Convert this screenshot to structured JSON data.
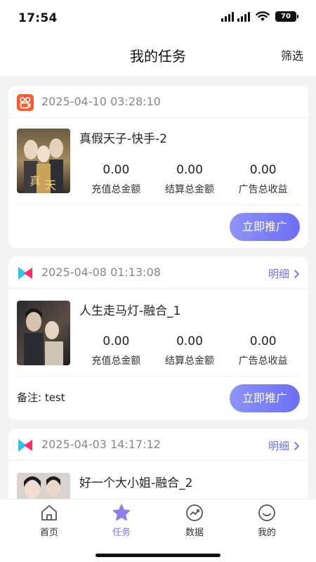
{
  "status_bar": {
    "time": "17:54",
    "battery": "70"
  },
  "header": {
    "title": "我的任务",
    "filter_label": "筛选"
  },
  "cards": [
    {
      "platform": "kuaishou",
      "date": "2025-04-10 03:28:10",
      "title": "真假天子-快手-2",
      "stats": [
        {
          "value": "0.00",
          "label": "充值总金额"
        },
        {
          "value": "0.00",
          "label": "结算总金额"
        },
        {
          "value": "0.00",
          "label": "广告总收益"
        }
      ],
      "button_label": "立即推广"
    },
    {
      "platform": "fusion",
      "date": "2025-04-08 01:13:08",
      "detail_label": "明细",
      "title": "人生走马灯-融合_1",
      "stats": [
        {
          "value": "0.00",
          "label": "充值总金额"
        },
        {
          "value": "0.00",
          "label": "结算总金额"
        },
        {
          "value": "0.00",
          "label": "广告总收益"
        }
      ],
      "remark": "备注: test",
      "button_label": "立即推广"
    },
    {
      "platform": "fusion",
      "date": "2025-04-03 14:17:12",
      "detail_label": "明细",
      "title": "好一个大小姐-融合_2"
    }
  ],
  "tab_bar": {
    "items": [
      {
        "label": "首页",
        "icon": "home-icon",
        "active": false
      },
      {
        "label": "任务",
        "icon": "star-icon",
        "active": true
      },
      {
        "label": "数据",
        "icon": "chart-icon",
        "active": false
      },
      {
        "label": "我的",
        "icon": "smile-icon",
        "active": false
      }
    ]
  },
  "colors": {
    "accent": "#6b6ff2",
    "background": "#f3f3f5",
    "kuaishou": "#ff5a2b"
  }
}
